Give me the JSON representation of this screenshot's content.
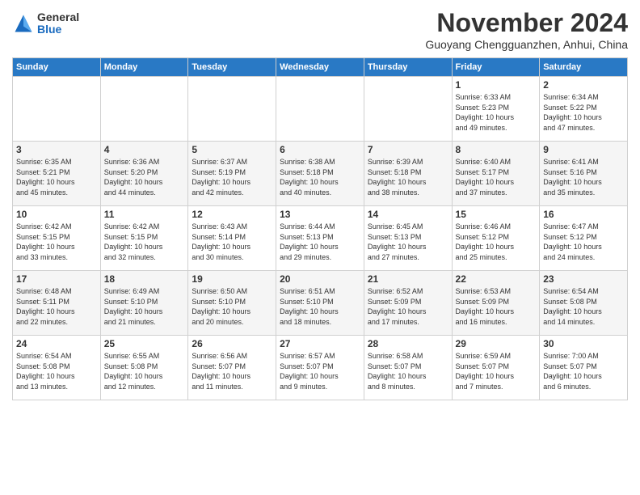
{
  "logo": {
    "general": "General",
    "blue": "Blue"
  },
  "header": {
    "month_year": "November 2024",
    "location": "Guoyang Chengguanzhen, Anhui, China"
  },
  "weekdays": [
    "Sunday",
    "Monday",
    "Tuesday",
    "Wednesday",
    "Thursday",
    "Friday",
    "Saturday"
  ],
  "weeks": [
    [
      {
        "day": "",
        "info": ""
      },
      {
        "day": "",
        "info": ""
      },
      {
        "day": "",
        "info": ""
      },
      {
        "day": "",
        "info": ""
      },
      {
        "day": "",
        "info": ""
      },
      {
        "day": "1",
        "info": "Sunrise: 6:33 AM\nSunset: 5:23 PM\nDaylight: 10 hours\nand 49 minutes."
      },
      {
        "day": "2",
        "info": "Sunrise: 6:34 AM\nSunset: 5:22 PM\nDaylight: 10 hours\nand 47 minutes."
      }
    ],
    [
      {
        "day": "3",
        "info": "Sunrise: 6:35 AM\nSunset: 5:21 PM\nDaylight: 10 hours\nand 45 minutes."
      },
      {
        "day": "4",
        "info": "Sunrise: 6:36 AM\nSunset: 5:20 PM\nDaylight: 10 hours\nand 44 minutes."
      },
      {
        "day": "5",
        "info": "Sunrise: 6:37 AM\nSunset: 5:19 PM\nDaylight: 10 hours\nand 42 minutes."
      },
      {
        "day": "6",
        "info": "Sunrise: 6:38 AM\nSunset: 5:18 PM\nDaylight: 10 hours\nand 40 minutes."
      },
      {
        "day": "7",
        "info": "Sunrise: 6:39 AM\nSunset: 5:18 PM\nDaylight: 10 hours\nand 38 minutes."
      },
      {
        "day": "8",
        "info": "Sunrise: 6:40 AM\nSunset: 5:17 PM\nDaylight: 10 hours\nand 37 minutes."
      },
      {
        "day": "9",
        "info": "Sunrise: 6:41 AM\nSunset: 5:16 PM\nDaylight: 10 hours\nand 35 minutes."
      }
    ],
    [
      {
        "day": "10",
        "info": "Sunrise: 6:42 AM\nSunset: 5:15 PM\nDaylight: 10 hours\nand 33 minutes."
      },
      {
        "day": "11",
        "info": "Sunrise: 6:42 AM\nSunset: 5:15 PM\nDaylight: 10 hours\nand 32 minutes."
      },
      {
        "day": "12",
        "info": "Sunrise: 6:43 AM\nSunset: 5:14 PM\nDaylight: 10 hours\nand 30 minutes."
      },
      {
        "day": "13",
        "info": "Sunrise: 6:44 AM\nSunset: 5:13 PM\nDaylight: 10 hours\nand 29 minutes."
      },
      {
        "day": "14",
        "info": "Sunrise: 6:45 AM\nSunset: 5:13 PM\nDaylight: 10 hours\nand 27 minutes."
      },
      {
        "day": "15",
        "info": "Sunrise: 6:46 AM\nSunset: 5:12 PM\nDaylight: 10 hours\nand 25 minutes."
      },
      {
        "day": "16",
        "info": "Sunrise: 6:47 AM\nSunset: 5:12 PM\nDaylight: 10 hours\nand 24 minutes."
      }
    ],
    [
      {
        "day": "17",
        "info": "Sunrise: 6:48 AM\nSunset: 5:11 PM\nDaylight: 10 hours\nand 22 minutes."
      },
      {
        "day": "18",
        "info": "Sunrise: 6:49 AM\nSunset: 5:10 PM\nDaylight: 10 hours\nand 21 minutes."
      },
      {
        "day": "19",
        "info": "Sunrise: 6:50 AM\nSunset: 5:10 PM\nDaylight: 10 hours\nand 20 minutes."
      },
      {
        "day": "20",
        "info": "Sunrise: 6:51 AM\nSunset: 5:10 PM\nDaylight: 10 hours\nand 18 minutes."
      },
      {
        "day": "21",
        "info": "Sunrise: 6:52 AM\nSunset: 5:09 PM\nDaylight: 10 hours\nand 17 minutes."
      },
      {
        "day": "22",
        "info": "Sunrise: 6:53 AM\nSunset: 5:09 PM\nDaylight: 10 hours\nand 16 minutes."
      },
      {
        "day": "23",
        "info": "Sunrise: 6:54 AM\nSunset: 5:08 PM\nDaylight: 10 hours\nand 14 minutes."
      }
    ],
    [
      {
        "day": "24",
        "info": "Sunrise: 6:54 AM\nSunset: 5:08 PM\nDaylight: 10 hours\nand 13 minutes."
      },
      {
        "day": "25",
        "info": "Sunrise: 6:55 AM\nSunset: 5:08 PM\nDaylight: 10 hours\nand 12 minutes."
      },
      {
        "day": "26",
        "info": "Sunrise: 6:56 AM\nSunset: 5:07 PM\nDaylight: 10 hours\nand 11 minutes."
      },
      {
        "day": "27",
        "info": "Sunrise: 6:57 AM\nSunset: 5:07 PM\nDaylight: 10 hours\nand 9 minutes."
      },
      {
        "day": "28",
        "info": "Sunrise: 6:58 AM\nSunset: 5:07 PM\nDaylight: 10 hours\nand 8 minutes."
      },
      {
        "day": "29",
        "info": "Sunrise: 6:59 AM\nSunset: 5:07 PM\nDaylight: 10 hours\nand 7 minutes."
      },
      {
        "day": "30",
        "info": "Sunrise: 7:00 AM\nSunset: 5:07 PM\nDaylight: 10 hours\nand 6 minutes."
      }
    ]
  ]
}
